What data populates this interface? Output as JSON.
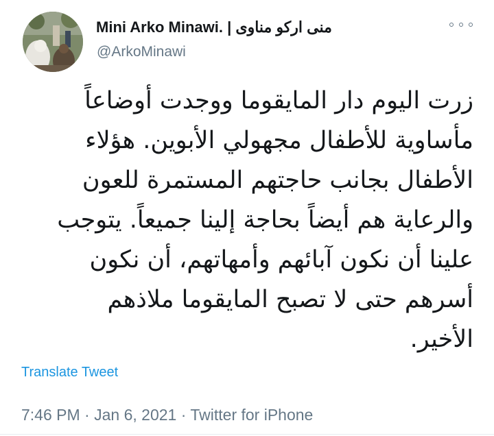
{
  "author": {
    "display_name": "Mini Arko Minawi. | منى اركو مناوى",
    "handle": "@ArkoMinawi"
  },
  "tweet": {
    "lines": [
      "زرت اليوم دار المايقوما ووجدت أوضاعاً",
      "مأساوية للأطفال مجهولي الأبوين. هؤلاء",
      "الأطفال بجانب حاجتهم المستمرة للعون",
      "والرعاية هم أيضاً بحاجة إلينا جميعاً. يتوجب",
      "علينا أن نكون آبائهم وأمهاتهم، أن نكون",
      "أسرهم  حتى لا تصبح المايقوما ملاذهم",
      "الأخير."
    ]
  },
  "actions": {
    "translate_label": "Translate Tweet",
    "more_icon": "more-options-icon"
  },
  "meta": {
    "time": "7:46 PM",
    "separator": "·",
    "date": "Jan 6, 2021",
    "source": "Twitter for iPhone"
  },
  "colors": {
    "text": "#14171a",
    "secondary": "#657786",
    "link": "#1b95e0"
  }
}
